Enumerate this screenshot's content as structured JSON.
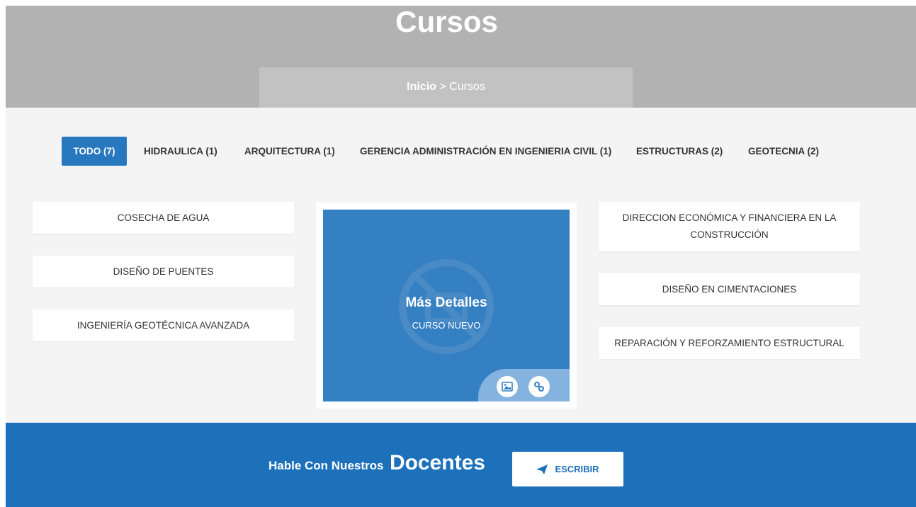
{
  "hero": {
    "title": "Cursos",
    "breadcrumb": {
      "home": "Inicio",
      "separator": " > ",
      "current": "Cursos"
    }
  },
  "filters": [
    {
      "label": "TODO (7)",
      "active": true
    },
    {
      "label": "HIDRAULICA (1)",
      "active": false
    },
    {
      "label": "ARQUITECTURA (1)",
      "active": false
    },
    {
      "label": "GERENCIA ADMINISTRACIÓN EN INGENIERIA CIVIL (1)",
      "active": false
    },
    {
      "label": "ESTRUCTURAS (2)",
      "active": false
    },
    {
      "label": "GEOTECNIA (2)",
      "active": false
    }
  ],
  "courses": {
    "left": [
      "COSECHA DE AGUA",
      "DISEÑO DE PUENTES",
      "INGENIERÍA GEOTÉCNICA AVANZADA"
    ],
    "right": [
      "DIRECCION ECONÓMICA Y FINANCIERA EN LA CONSTRUCCIÓN",
      "DISEÑO EN CIMENTACIONES",
      "REPARACIÓN Y REFORZAMIENTO ESTRUCTURAL"
    ]
  },
  "featured": {
    "title": "Más Detalles",
    "subtitle": "CURSO NUEVO",
    "actions": [
      "image-icon",
      "link-icon"
    ]
  },
  "cta": {
    "lead": "Hable Con Nuestros",
    "strong": "Docentes",
    "button_label": "ESCRIBIR"
  },
  "colors": {
    "primary": "#2878c0",
    "cta_background": "#1d71bb",
    "hero_background": "#b2b2b2",
    "content_background": "#f4f4f4"
  }
}
